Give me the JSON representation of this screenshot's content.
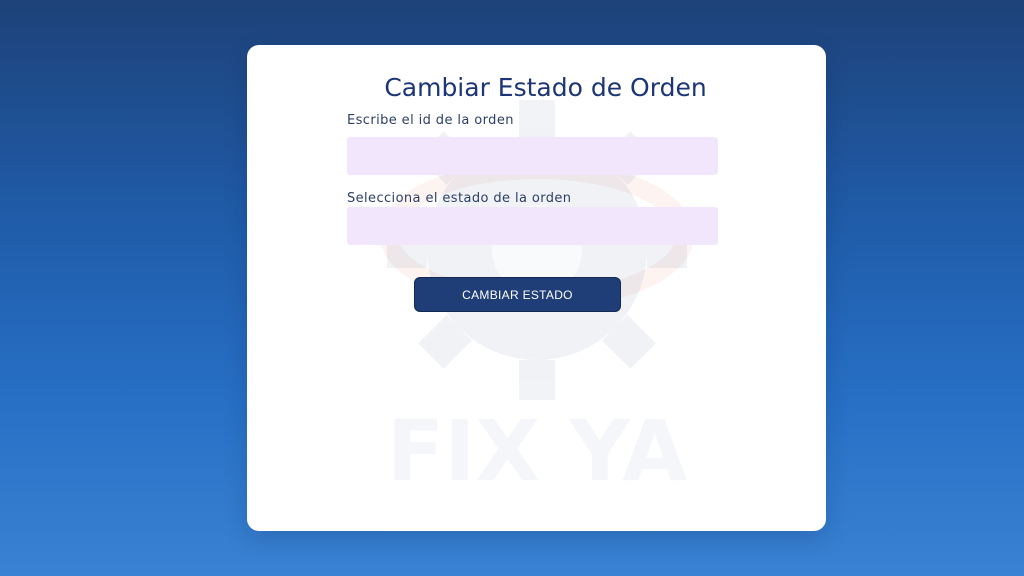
{
  "form": {
    "title": "Cambiar Estado de Orden",
    "order_id_label": "Escribe el id de la orden",
    "order_id_value": "",
    "status_label": "Selecciona el estado de la orden",
    "status_value": "",
    "submit_label": "CAMBIAR ESTADO"
  },
  "watermark": {
    "brand_text": "FIX YA",
    "icon": "gear-icon"
  },
  "colors": {
    "background_top": "#1e4279",
    "background_bottom": "#3a82d2",
    "title": "#1c3576",
    "field_bg": "#f2e6fc",
    "button_bg": "#1f3e78"
  }
}
